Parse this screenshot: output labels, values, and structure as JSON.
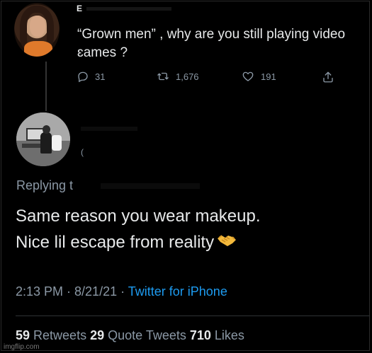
{
  "colors": {
    "background": "#000000",
    "text_primary": "#e7e9ea",
    "text_secondary": "#8b98a5",
    "link": "#1d9bf0",
    "divider": "#2f3336"
  },
  "parent_tweet": {
    "name_fragment": "E",
    "text": "“Grown men” , why are you still playing video ɛames ?",
    "actions": {
      "reply_count": "31",
      "retweet_count": "1,676",
      "like_count": "191"
    },
    "icons": [
      "reply-icon",
      "retweet-icon",
      "like-icon",
      "share-icon"
    ]
  },
  "reply_tweet": {
    "handle_fragment": "(",
    "replying_label": "Replying t",
    "text_line1": "Same reason you wear makeup.",
    "text_line2": "Nice lil escape from reality",
    "emoji": "handshake-icon",
    "timestamp": "2:13 PM · 8/21/21 · ",
    "source": "Twitter for iPhone",
    "stats": {
      "retweets_count": "59",
      "retweets_label": " Retweets ",
      "quotes_count": "29",
      "quotes_label": " Quote Tweets ",
      "likes_count": "710",
      "likes_label": " Likes"
    }
  },
  "watermark": "imgflip.com"
}
